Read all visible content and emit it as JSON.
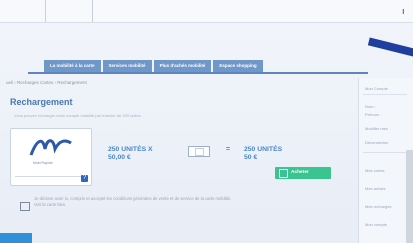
{
  "tabs": [
    {
      "label": "La mobilité à la carte"
    },
    {
      "label": "Services mobilité"
    },
    {
      "label": "Plus d'achés mobilité"
    },
    {
      "label": "Espace shopping"
    }
  ],
  "breadcrumb": "ueil › Recharges Cartes › Rechargement",
  "page": {
    "title": "Rechargement",
    "subtitle": "Vous pouvez recharger votre compte mobilité par tranche de 250 unités"
  },
  "card": {
    "brand": "Mobi Rapide"
  },
  "offer": {
    "left_units": "250 UNITÉS X",
    "left_price": "50,00 €",
    "equals": "=",
    "right_units": "250 UNITÉS",
    "right_price": "50 €",
    "quantity": ""
  },
  "pay_button": {
    "label": "Acheter"
  },
  "notice": {
    "text": "Je déclare avoir lu, compris et accepté les conditions générales de vente et de service de la carte mobilité. Voir la carte bleu"
  },
  "right_column": [
    {
      "label": "Mon Compte"
    },
    {
      "label": "Nom :"
    },
    {
      "label": "Prénom :"
    },
    {
      "label": "Modifier mes"
    },
    {
      "label": "Déconnexion"
    },
    {
      "label": "Mes cartes"
    },
    {
      "label": "Mes achats"
    },
    {
      "label": "Mes recharges"
    },
    {
      "label": "Mon compte"
    }
  ],
  "colors": {
    "accent": "#4c87c8",
    "tab": "#6f97c9",
    "pay": "#3ac48f",
    "title": "#4b77b2"
  }
}
